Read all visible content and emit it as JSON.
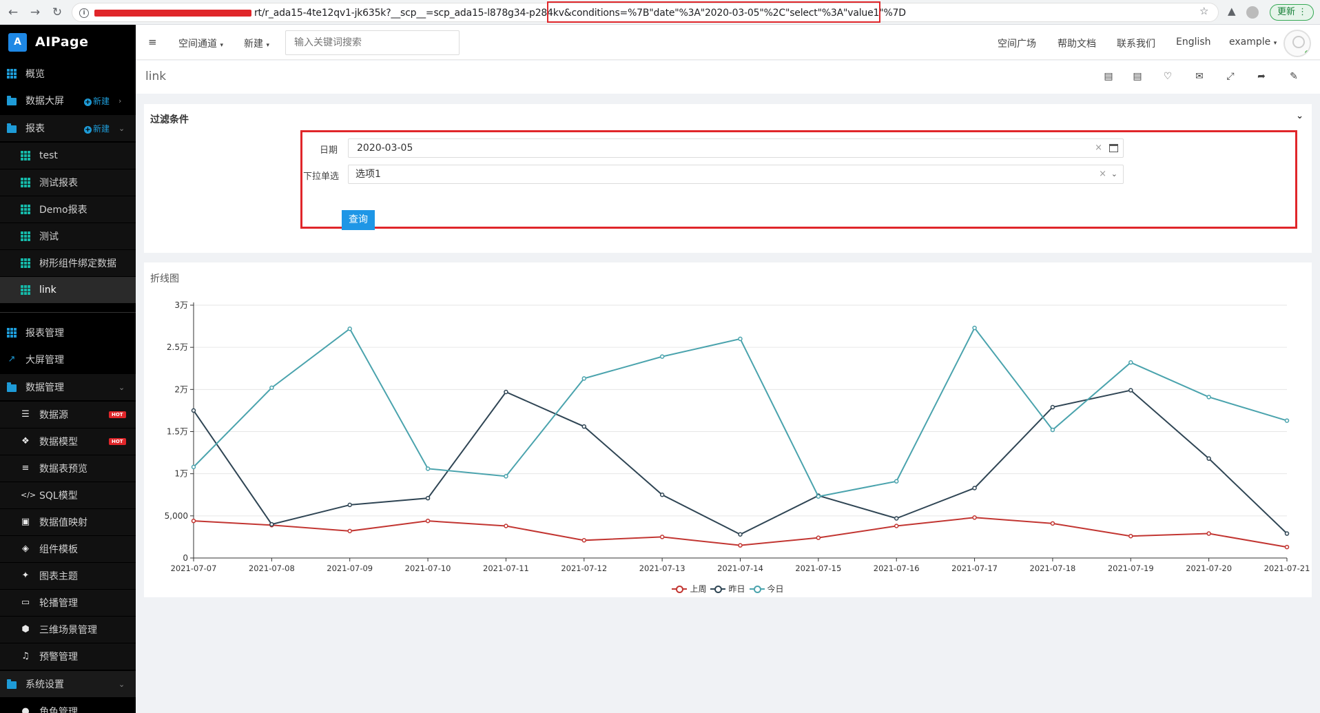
{
  "browser": {
    "url_text": "rt/r_ada15-4te12qv1-jk635k?__scp__=scp_ada15-l878g34-p284kv&conditions=%7B\"date\"%3A\"2020-03-05\"%2C\"select\"%3A\"value1\"%7D",
    "update_label": "更新"
  },
  "app": {
    "logo_letter": "A",
    "name": "AIPage"
  },
  "sidebar": {
    "items": [
      {
        "label": "概览"
      },
      {
        "label": "数据大屏",
        "new_label": "新建"
      },
      {
        "label": "报表",
        "new_label": "新建"
      },
      {
        "label": "test"
      },
      {
        "label": "测试报表"
      },
      {
        "label": "Demo报表"
      },
      {
        "label": "测试"
      },
      {
        "label": "树形组件绑定数据"
      },
      {
        "label": "link"
      },
      {
        "label": "报表管理"
      },
      {
        "label": "大屏管理"
      },
      {
        "label": "数据管理"
      },
      {
        "label": "数据源",
        "badge": "HOT"
      },
      {
        "label": "数据模型",
        "badge": "HOT"
      },
      {
        "label": "数据表预览"
      },
      {
        "label": "SQL模型"
      },
      {
        "label": "数据值映射"
      },
      {
        "label": "组件模板"
      },
      {
        "label": "图表主题"
      },
      {
        "label": "轮播管理"
      },
      {
        "label": "三维场景管理"
      },
      {
        "label": "预警管理"
      },
      {
        "label": "系统设置"
      },
      {
        "label": "角色管理"
      }
    ]
  },
  "header": {
    "space_channel": "空间通道",
    "new_menu": "新建",
    "search_placeholder": "输入关键词搜索",
    "space_square": "空间广场",
    "help_docs": "帮助文档",
    "contact_us": "联系我们",
    "language": "English",
    "user": "example"
  },
  "page": {
    "title": "link"
  },
  "filter": {
    "title": "过滤条件",
    "date_label": "日期",
    "date_value": "2020-03-05",
    "select_label": "下拉单选",
    "select_value": "选项1",
    "query_label": "查询"
  },
  "chart_panel": {
    "title": "折线图"
  },
  "chart_data": {
    "type": "line",
    "x": [
      "2021-07-07",
      "2021-07-08",
      "2021-07-09",
      "2021-07-10",
      "2021-07-11",
      "2021-07-12",
      "2021-07-13",
      "2021-07-14",
      "2021-07-15",
      "2021-07-16",
      "2021-07-17",
      "2021-07-18",
      "2021-07-19",
      "2021-07-20",
      "2021-07-21"
    ],
    "y_ticks": [
      "0",
      "5,000",
      "1万",
      "1.5万",
      "2万",
      "2.5万",
      "3万"
    ],
    "ylim": [
      0,
      30000
    ],
    "grid": true,
    "legend_position": "bottom",
    "series": [
      {
        "name": "上周",
        "color": "#c23531",
        "values": [
          4400,
          3900,
          3200,
          4400,
          3800,
          2100,
          2500,
          1500,
          2400,
          3800,
          4800,
          4100,
          2600,
          2900,
          1300
        ]
      },
      {
        "name": "昨日",
        "color": "#2f4554",
        "values": [
          17500,
          4000,
          6300,
          7100,
          19700,
          15600,
          7500,
          2800,
          7400,
          4700,
          8300,
          17900,
          19900,
          11800,
          2900
        ]
      },
      {
        "name": "今日",
        "color": "#4aa3ad",
        "values": [
          10800,
          20200,
          27200,
          10600,
          9700,
          21300,
          23900,
          26000,
          7300,
          9100,
          27300,
          15200,
          23200,
          19100,
          16300
        ]
      }
    ]
  }
}
